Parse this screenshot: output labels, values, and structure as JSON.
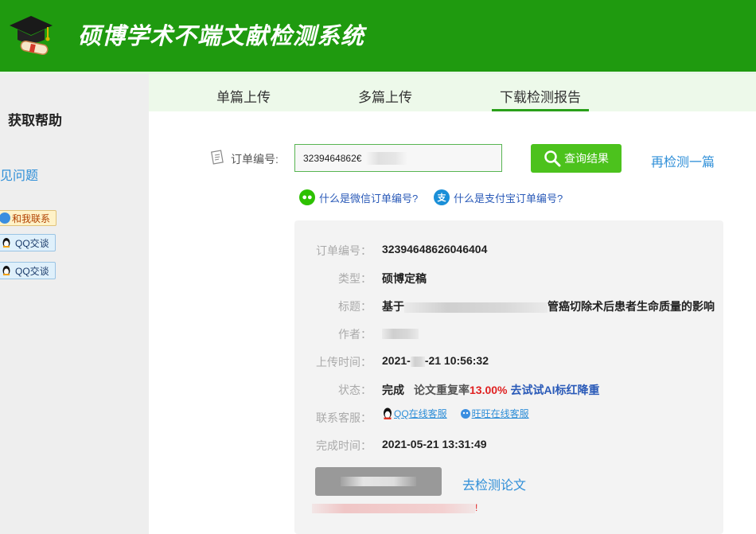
{
  "header": {
    "title": "硕博学术不端文献检测系统"
  },
  "sidebar": {
    "title": "获取帮助",
    "faq_link": "见问题",
    "contact_label": "和我联系",
    "qq_label_1": "QQ交谈",
    "qq_label_2": "QQ交谈"
  },
  "tabs": [
    {
      "label": "单篇上传"
    },
    {
      "label": "多篇上传"
    },
    {
      "label": "下载检测报告",
      "active": true
    }
  ],
  "search": {
    "label": "订单编号:",
    "value": "3239464862€",
    "button": "查询结果",
    "recheck": "再检测一篇",
    "wechat_help": "什么是微信订单编号?",
    "alipay_help": "什么是支付宝订单编号?"
  },
  "result": {
    "order_label": "订单编号：",
    "order_value": "32394648626046404",
    "type_label": "类型：",
    "type_value": "硕博定稿",
    "title_label": "标题：",
    "title_prefix": "基于",
    "title_suffix": "管癌切除术后患者生命质量的影响",
    "author_label": "作者：",
    "upload_label": "上传时间：",
    "upload_prefix": "2021-",
    "upload_suffix": "-21 10:56:32",
    "status_label": "状态：",
    "status_value": "完成",
    "rate_label": "论文重复率",
    "rate_value": "13.00%",
    "ai_link": "去试试AI标红降重",
    "service_label": "联系客服：",
    "qq_service": "QQ在线客服",
    "wangwang_service": "旺旺在线客服",
    "finish_label": "完成时间：",
    "finish_value": "2021-05-21 13:31:49",
    "go_check": "去检测论文",
    "warn_end": "!"
  },
  "colors": {
    "header_green": "#1f9a0f",
    "tab_bg": "#edf9ea",
    "button_green": "#4cc21d",
    "link_blue": "#2f8fd8",
    "rate_red": "#e02222"
  }
}
